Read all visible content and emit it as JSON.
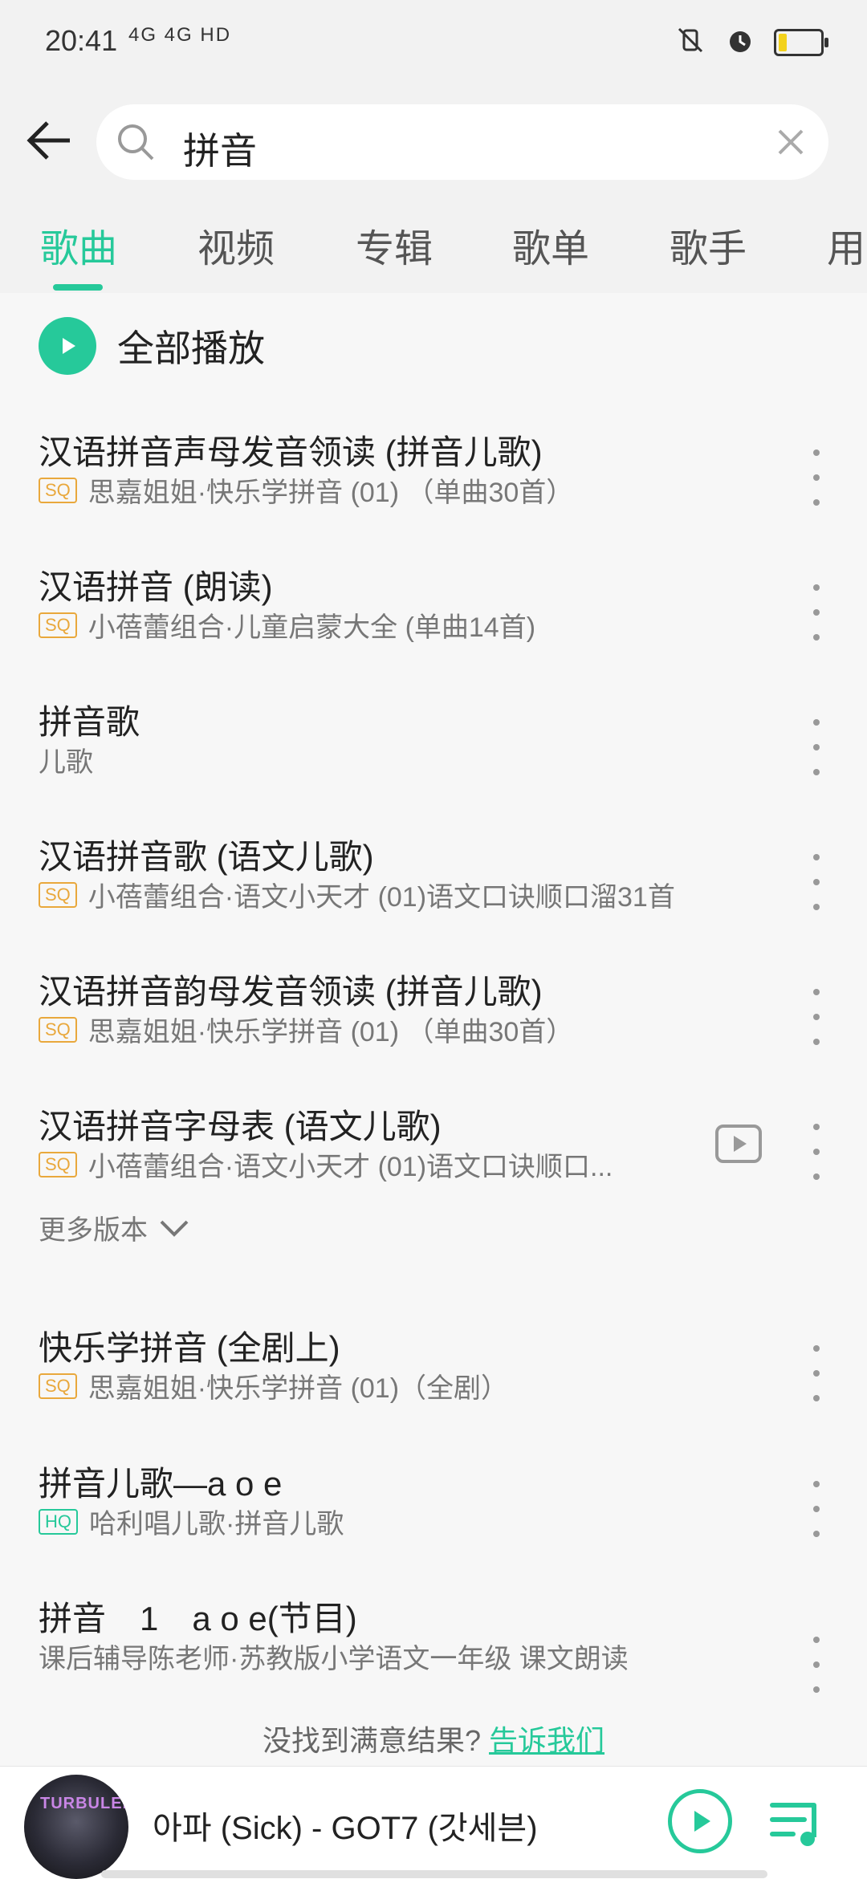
{
  "status": {
    "time": "20:41",
    "network": "4G 4G HD"
  },
  "search": {
    "query": "拼音"
  },
  "tabs": [
    {
      "label": "歌曲",
      "active": true
    },
    {
      "label": "视频"
    },
    {
      "label": "专辑"
    },
    {
      "label": "歌单"
    },
    {
      "label": "歌手"
    },
    {
      "label": "用"
    }
  ],
  "play_all_label": "全部播放",
  "songs": [
    {
      "title": "汉语拼音声母发音领读 (拼音儿歌)",
      "badge": "SQ",
      "subtitle": "思嘉姐姐·快乐学拼音 (01) （单曲30首）"
    },
    {
      "title": "汉语拼音 (朗读)",
      "badge": "SQ",
      "subtitle": "小蓓蕾组合·儿童启蒙大全 (单曲14首)"
    },
    {
      "title": "拼音歌",
      "badge": "",
      "subtitle": "儿歌"
    },
    {
      "title": "汉语拼音歌 (语文儿歌)",
      "badge": "SQ",
      "subtitle": "小蓓蕾组合·语文小天才 (01)语文口诀顺口溜31首"
    },
    {
      "title": "汉语拼音韵母发音领读 (拼音儿歌)",
      "badge": "SQ",
      "subtitle": "思嘉姐姐·快乐学拼音 (01) （单曲30首）"
    },
    {
      "title": "汉语拼音字母表 (语文儿歌)",
      "badge": "SQ",
      "subtitle": "小蓓蕾组合·语文小天才 (01)语文口诀顺口..."
    },
    {
      "title": "快乐学拼音 (全剧上)",
      "badge": "SQ",
      "subtitle": "思嘉姐姐·快乐学拼音 (01)（全剧）"
    },
    {
      "title": "拼音儿歌—a o e",
      "badge": "HQ",
      "subtitle": "哈利唱儿歌·拼音儿歌"
    },
    {
      "title": "拼音　1　a o e(节目)",
      "badge": "",
      "subtitle": "课后辅导陈老师·苏教版小学语文一年级 课文朗读"
    }
  ],
  "more_versions": "更多版本",
  "feedback": {
    "text": "没找到满意结果?",
    "link": "告诉我们"
  },
  "player": {
    "album_text": "TURBULENCE",
    "now_playing": "아파 (Sick) - GOT7 (갓세븐)"
  },
  "colors": {
    "accent": "#26c99a",
    "sq_badge": "#e9a83c"
  }
}
